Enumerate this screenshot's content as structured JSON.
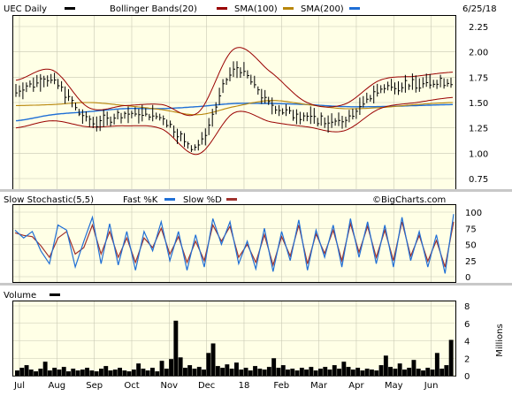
{
  "header": {
    "symbol_label": "UEC Daily",
    "bollinger_label": "Bollinger Bands(20)",
    "sma100_label": "SMA(100)",
    "sma200_label": "SMA(200)",
    "date": "6/25/18"
  },
  "colors": {
    "price": "#000000",
    "bollinger": "#990000",
    "sma100": "#b8860b",
    "sma200": "#1f6fd6",
    "fast_k": "#1f6fd6",
    "slow_d": "#a0322d",
    "volume": "#000000",
    "panel_bg": "#ffffe6",
    "grid": "#c8c8b4"
  },
  "chart_data": [
    {
      "type": "line",
      "panel": "price",
      "ylim": [
        0.75,
        2.25
      ],
      "yticks": [
        "2.25",
        "2.00",
        "1.75",
        "1.50",
        "1.25",
        "1.00",
        "0.75"
      ],
      "xticks": [
        "Jul",
        "Aug",
        "Sep",
        "Oct",
        "Nov",
        "Dec",
        "18",
        "Feb",
        "Mar",
        "Apr",
        "May",
        "Jun"
      ],
      "x": [
        "Jul",
        "Aug",
        "Sep",
        "Oct",
        "Nov",
        "Dec",
        "Jan",
        "Feb",
        "Mar",
        "Apr",
        "May",
        "Jun",
        "Jun 25"
      ],
      "series": [
        {
          "name": "UEC Daily",
          "values": [
            1.62,
            1.72,
            1.32,
            1.38,
            1.35,
            1.08,
            1.82,
            1.48,
            1.36,
            1.32,
            1.63,
            1.68,
            1.72
          ]
        },
        {
          "name": "Bollinger Bands(20)",
          "role": "upper",
          "values": [
            1.72,
            1.82,
            1.45,
            1.47,
            1.48,
            1.4,
            2.03,
            1.8,
            1.5,
            1.48,
            1.72,
            1.76,
            1.8
          ]
        },
        {
          "name": "Bollinger Bands(20)",
          "role": "lower",
          "values": [
            1.25,
            1.32,
            1.26,
            1.27,
            1.24,
            0.99,
            1.4,
            1.31,
            1.26,
            1.22,
            1.44,
            1.5,
            1.55
          ]
        },
        {
          "name": "SMA(100)",
          "values": [
            1.47,
            1.48,
            1.5,
            1.47,
            1.43,
            1.38,
            1.46,
            1.52,
            1.48,
            1.44,
            1.45,
            1.48,
            1.5
          ]
        },
        {
          "name": "SMA(200)",
          "values": [
            1.32,
            1.38,
            1.41,
            1.44,
            1.44,
            1.46,
            1.49,
            1.49,
            1.48,
            1.46,
            1.46,
            1.47,
            1.48
          ]
        }
      ]
    },
    {
      "type": "line",
      "panel": "stochastic",
      "title": "Slow Stochastic(5,5)",
      "watermark": "©BigCharts.com",
      "ylim": [
        0,
        100
      ],
      "yticks": [
        "100",
        "75",
        "50",
        "25",
        "0"
      ],
      "series": [
        {
          "name": "Fast %K",
          "values": [
            72,
            60,
            70,
            40,
            20,
            80,
            72,
            15,
            55,
            92,
            20,
            82,
            18,
            70,
            10,
            70,
            40,
            85,
            25,
            70,
            10,
            65,
            15,
            90,
            50,
            85,
            20,
            55,
            12,
            75,
            8,
            70,
            25,
            88,
            10,
            72,
            30,
            80,
            15,
            90,
            30,
            85,
            20,
            80,
            15,
            92,
            25,
            70,
            15,
            65,
            5,
            97
          ]
        },
        {
          "name": "Slow %D",
          "values": [
            68,
            64,
            62,
            48,
            30,
            60,
            70,
            35,
            45,
            80,
            35,
            70,
            30,
            60,
            22,
            60,
            45,
            75,
            35,
            62,
            22,
            55,
            25,
            80,
            55,
            78,
            30,
            50,
            22,
            65,
            18,
            62,
            32,
            80,
            20,
            66,
            36,
            72,
            25,
            82,
            38,
            78,
            30,
            72,
            25,
            85,
            32,
            64,
            24,
            56,
            15,
            85
          ]
        }
      ]
    },
    {
      "type": "bar",
      "panel": "volume",
      "title": "Volume",
      "ylabel": "Millions",
      "ylim": [
        0,
        8
      ],
      "yticks": [
        "8",
        "6",
        "4",
        "2",
        "0"
      ],
      "series": [
        {
          "name": "Volume",
          "values": [
            0.6,
            0.9,
            1.2,
            0.7,
            0.5,
            0.8,
            1.6,
            0.6,
            0.9,
            0.7,
            1.0,
            0.5,
            0.8,
            0.6,
            0.7,
            0.9,
            0.6,
            0.5,
            0.8,
            1.1,
            0.6,
            0.7,
            0.9,
            0.6,
            0.5,
            0.7,
            1.4,
            0.8,
            0.6,
            0.9,
            0.5,
            1.7,
            0.8,
            1.9,
            6.3,
            2.1,
            0.9,
            1.2,
            0.8,
            1.0,
            0.7,
            2.6,
            3.7,
            1.1,
            0.9,
            1.3,
            0.8,
            1.5,
            0.7,
            0.9,
            0.6,
            1.1,
            0.8,
            0.7,
            1.0,
            2.0,
            0.9,
            1.2,
            0.7,
            0.8,
            0.6,
            0.9,
            0.7,
            1.0,
            0.6,
            0.8,
            1.0,
            0.7,
            1.2,
            0.8,
            1.6,
            1.0,
            0.7,
            0.9,
            0.6,
            0.8,
            0.7,
            0.6,
            1.2,
            2.3,
            1.0,
            0.8,
            1.4,
            0.7,
            0.9,
            1.8,
            0.8,
            0.6,
            0.9,
            0.7,
            2.6,
            0.8,
            1.2,
            4.1
          ]
        }
      ]
    }
  ]
}
